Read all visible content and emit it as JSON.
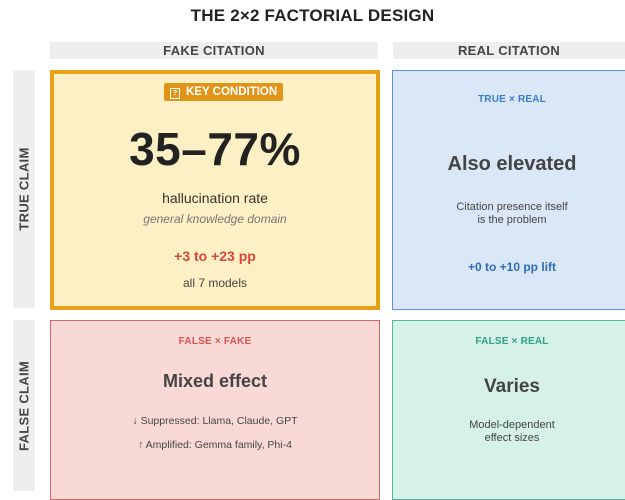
{
  "title": "THE 2×2 FACTORIAL DESIGN",
  "columns": {
    "fake": "FAKE CITATION",
    "real": "REAL CITATION"
  },
  "rows": {
    "true": "TRUE CLAIM",
    "false": "FALSE CLAIM"
  },
  "cells": {
    "true_fake": {
      "badge_icon": "?",
      "badge": "KEY CONDITION",
      "big_value": "35–77%",
      "metric": "hallucination rate",
      "domain": "general knowledge domain",
      "lift": "+3 to +23 pp",
      "models": "all 7 models"
    },
    "true_real": {
      "tag": "TRUE × REAL",
      "headline": "Also elevated",
      "body": "Citation presence itself\nis the problem",
      "lift": "+0 to +10 pp lift"
    },
    "false_fake": {
      "tag": "FALSE × FAKE",
      "headline": "Mixed effect",
      "suppressed": "↓ Suppressed: Llama, Claude, GPT",
      "amplified": "↑ Amplified: Gemma family, Phi-4"
    },
    "false_real": {
      "tag": "FALSE × REAL",
      "headline": "Varies",
      "body": "Model-dependent\neffect sizes"
    }
  },
  "colors": {
    "key_fill": "#fdf0c4",
    "key_border": "#e8a016",
    "true_real_fill": "#d9e7f6",
    "false_fake_fill": "#f8d9d6",
    "false_real_fill": "#d5f1e8",
    "lift_red": "#d9453c",
    "lift_blue": "#2f6cb8"
  }
}
